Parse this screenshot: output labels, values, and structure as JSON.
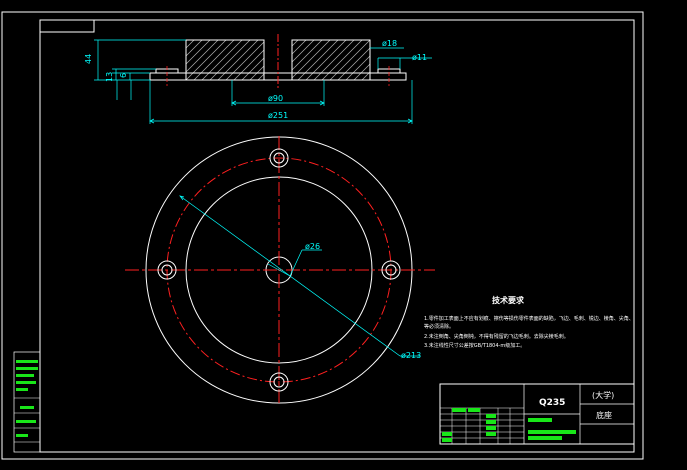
{
  "drawing": {
    "section_dims": {
      "d18": "ø18",
      "d11": "ø11",
      "h44": "44",
      "h13": "13",
      "h6": "6",
      "d90": "ø90",
      "d251": "ø251"
    },
    "plan_dims": {
      "d26": "ø26",
      "d213": "ø213"
    },
    "tech_req": {
      "heading": "技术要求",
      "lines": [
        "1.零件加工表面上不应有划痕、擦伤等损伤零件表面的缺陷，飞边、毛刺、锐边、棱角、尖角、",
        "等必须清除。",
        "2.未注倒角、尖角倒钝，不得有残留的飞边毛刺。去除尖棱毛刺。",
        "3.未注线性尺寸公差按GB/T1804-m级加工。"
      ]
    },
    "title_block": {
      "material": "Q235",
      "org": "(大学)",
      "part_name": "底座"
    }
  },
  "colors": {
    "frame": "#ffffff",
    "dimension": "#00ffff",
    "centerline": "#ff2020",
    "hatch": "#b0b0b0",
    "fill_green": "#19e619"
  }
}
